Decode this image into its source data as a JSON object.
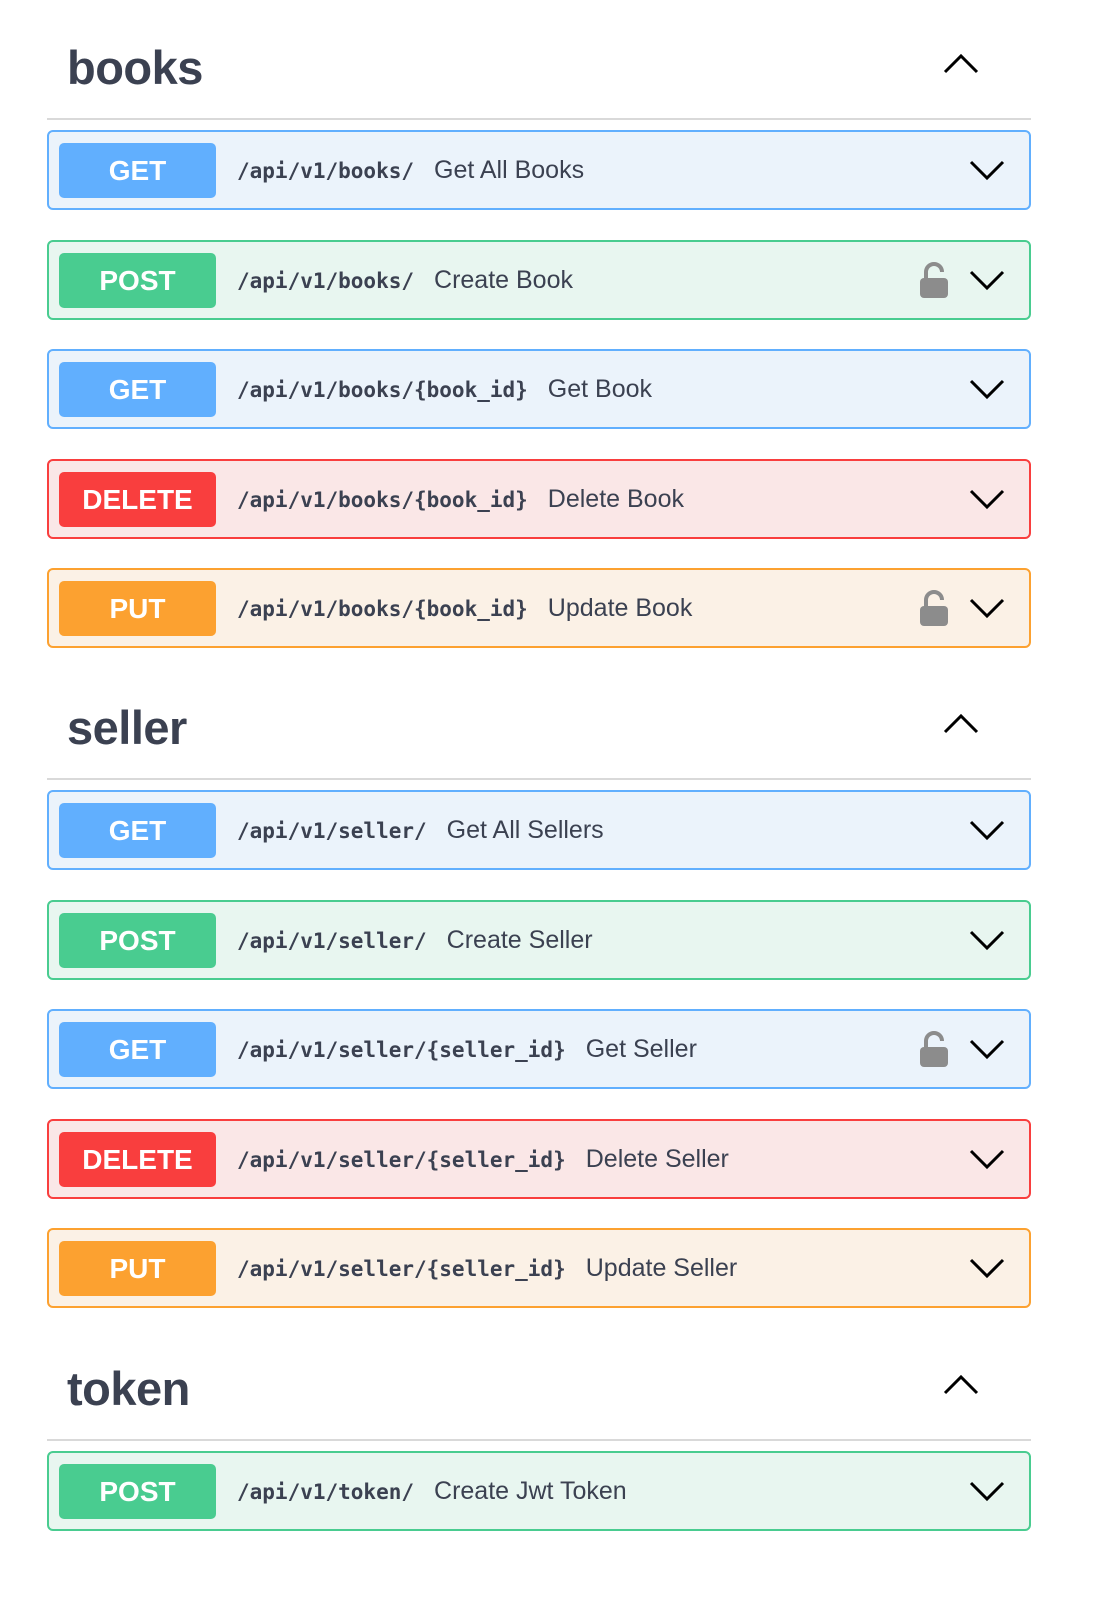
{
  "colors": {
    "get": "#61affe",
    "post": "#49cc90",
    "delete": "#f93e3e",
    "put": "#fca130",
    "text": "#3b4151"
  },
  "sections": [
    {
      "name": "books",
      "expanded": true,
      "operations": [
        {
          "method": "GET",
          "path": "/api/v1/books/",
          "summary": "Get All Books",
          "locked": false
        },
        {
          "method": "POST",
          "path": "/api/v1/books/",
          "summary": "Create Book",
          "locked": true
        },
        {
          "method": "GET",
          "path": "/api/v1/books/{book_id}",
          "summary": "Get Book",
          "locked": false
        },
        {
          "method": "DELETE",
          "path": "/api/v1/books/{book_id}",
          "summary": "Delete Book",
          "locked": false
        },
        {
          "method": "PUT",
          "path": "/api/v1/books/{book_id}",
          "summary": "Update Book",
          "locked": true
        }
      ]
    },
    {
      "name": "seller",
      "expanded": true,
      "operations": [
        {
          "method": "GET",
          "path": "/api/v1/seller/",
          "summary": "Get All Sellers",
          "locked": false
        },
        {
          "method": "POST",
          "path": "/api/v1/seller/",
          "summary": "Create Seller",
          "locked": false
        },
        {
          "method": "GET",
          "path": "/api/v1/seller/{seller_id}",
          "summary": "Get Seller",
          "locked": true
        },
        {
          "method": "DELETE",
          "path": "/api/v1/seller/{seller_id}",
          "summary": "Delete Seller",
          "locked": false
        },
        {
          "method": "PUT",
          "path": "/api/v1/seller/{seller_id}",
          "summary": "Update Seller",
          "locked": false
        }
      ]
    },
    {
      "name": "token",
      "expanded": true,
      "operations": [
        {
          "method": "POST",
          "path": "/api/v1/token/",
          "summary": "Create Jwt Token",
          "locked": false
        }
      ]
    }
  ],
  "icons": {
    "section_toggle": "chevron-up-icon",
    "operation_toggle": "chevron-down-icon",
    "auth": "lock-icon"
  }
}
